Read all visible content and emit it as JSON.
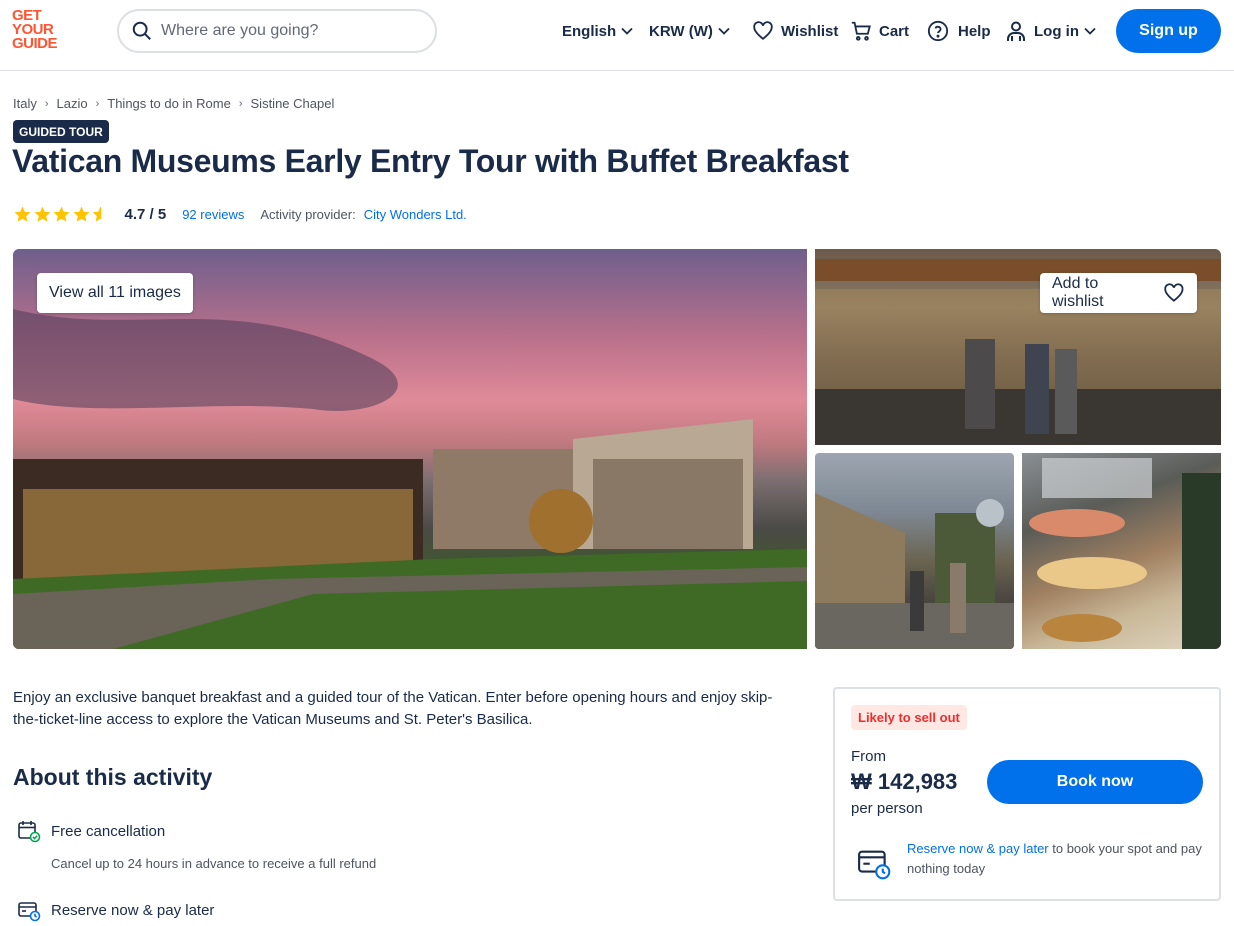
{
  "header": {
    "logo_lines": [
      "GET",
      "YOUR",
      "GUIDE"
    ],
    "search_placeholder": "Where are you going?",
    "language": "English",
    "currency": "KRW (W)",
    "wishlist": "Wishlist",
    "cart": "Cart",
    "help": "Help",
    "login": "Log in",
    "signup": "Sign up"
  },
  "breadcrumb": [
    "Italy",
    "Lazio",
    "Things to do in Rome",
    "Sistine Chapel"
  ],
  "badge": "GUIDED TOUR",
  "title": "Vatican Museums Early Entry Tour with Buffet Breakfast",
  "rating": {
    "stars": 4.7,
    "score": "4.7 / 5",
    "reviews": "92 reviews",
    "provider_label": "Activity provider:",
    "provider": "City Wonders Ltd."
  },
  "gallery": {
    "view_all": "View all 11 images",
    "add_wishlist": "Add to wishlist"
  },
  "intro": "Enjoy an exclusive banquet breakfast and a guided tour of the Vatican. Enter before opening hours and enjoy skip-the-ticket-line access to explore the Vatican Museums and St. Peter's Basilica.",
  "about": {
    "heading": "About this activity",
    "features": [
      {
        "title": "Free cancellation",
        "desc": "Cancel up to 24 hours in advance to receive a full refund"
      },
      {
        "title": "Reserve now & pay later"
      }
    ]
  },
  "booking": {
    "urgency": "Likely to sell out",
    "from": "From",
    "price": "₩ 142,983",
    "per": "per person",
    "book": "Book now",
    "rnpl_link": "Reserve now & pay later",
    "rnpl_text": " to book your spot and pay nothing today"
  },
  "colors": {
    "brand": "#ff5533",
    "primary": "#0071eb",
    "text": "#1a2b49",
    "star": "#ffc300",
    "urgency_bg": "#ffe8e3",
    "urgency_text": "#eb2f2f"
  }
}
